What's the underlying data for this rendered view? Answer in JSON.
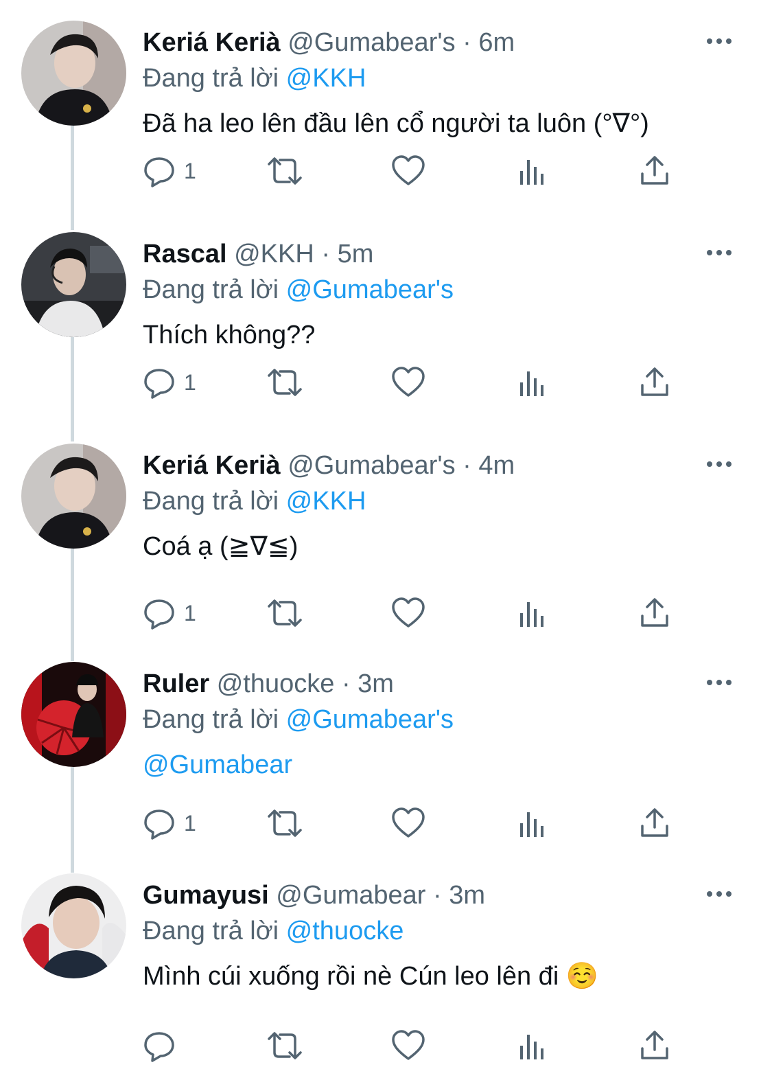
{
  "tweets": [
    {
      "name": "Keriá Kerià",
      "handle": "@Gumabear's",
      "time": "6m",
      "replying_prefix": "Đang trả lời",
      "replying_to": "@KKH",
      "text": "Đã ha leo lên đầu lên cổ người ta luôn (°∇°)",
      "reply_count": "1",
      "avatar": "keria",
      "body_is_link": false
    },
    {
      "name": "Rascal",
      "handle": "@KKH",
      "time": "5m",
      "replying_prefix": "Đang trả lời",
      "replying_to": "@Gumabear's",
      "text": "Thích không??",
      "reply_count": "1",
      "avatar": "rascal",
      "body_is_link": false
    },
    {
      "name": "Keriá Kerià",
      "handle": "@Gumabear's",
      "time": "4m",
      "replying_prefix": "Đang trả lời",
      "replying_to": "@KKH",
      "text": "Coá ạ (≧∇≦)",
      "reply_count": "1",
      "avatar": "keria",
      "body_is_link": false
    },
    {
      "name": "Ruler",
      "handle": "@thuocke",
      "time": "3m",
      "replying_prefix": "Đang trả lời",
      "replying_to": "@Gumabear's",
      "text": "@Gumabear",
      "reply_count": "1",
      "avatar": "ruler",
      "body_is_link": true
    },
    {
      "name": "Gumayusi",
      "handle": "@Gumabear",
      "time": "3m",
      "replying_prefix": "Đang trả lời",
      "replying_to": "@thuocke",
      "text": "Mình cúi xuống rồi nè Cún leo lên đi ☺️",
      "reply_count": "",
      "avatar": "gumayusi",
      "body_is_link": false
    }
  ],
  "separator": "·",
  "colors": {
    "accent": "#1d9bf0",
    "secondary": "#536471",
    "thread_line": "#cfd9de"
  },
  "icons": [
    "reply-icon",
    "retweet-icon",
    "like-icon",
    "views-icon",
    "share-icon",
    "more-icon"
  ]
}
